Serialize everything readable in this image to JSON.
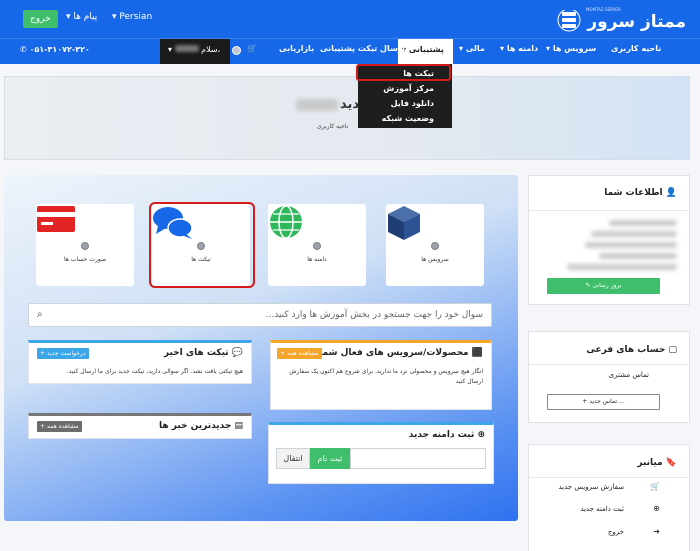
{
  "header": {
    "exit_label": "خروج",
    "messages_label": "پیام ها",
    "language_label": "Persian",
    "logo_text": "ممتاز سرور",
    "logo_sub": "MOMTAZ SERVER"
  },
  "nav": {
    "items": [
      "ناحیه کاربری",
      "سرویس ها",
      "دامنه ها",
      "مالی",
      "پشتیبانی",
      "ارسال تیکت پشتیبانی",
      "بازاریابی"
    ],
    "user_greeting": "سلام،",
    "phone": "۰۵۱-۳۱۰۷۲-۳۲۰"
  },
  "dropdown": {
    "items": [
      "تیکت ها",
      "مرکز آموزش",
      "دانلود فایل",
      "وضعیت شبکه"
    ]
  },
  "hero": {
    "title": "مدید،",
    "subtitle": "ناحیه کاربری"
  },
  "tiles": [
    {
      "label": "سرویس ها",
      "count": "0"
    },
    {
      "label": "دامنه ها",
      "count": "0"
    },
    {
      "label": "تیکت ها",
      "count": "0"
    },
    {
      "label": "صورت حساب ها",
      "count": "0"
    }
  ],
  "search": {
    "placeholder": "سوال خود را جهت جستجو در بخش آموزش ها وارد کنید..."
  },
  "panels": {
    "products": {
      "title": "محصولات/سرویس های فعال شما",
      "badge": "مشاهده همه",
      "body": "انگار هیچ سرویس و محصولی نزد ما ندارید. برای شروع هم اکنون یک سفارش ارسال کنید"
    },
    "tickets": {
      "title": "تیکت های اخیر",
      "badge": "درخواست جدید",
      "body": "هیچ تیکتی یافت نشد. اگر سوالی دارید، تیکت جدید برای ما ارسال کنید."
    },
    "news": {
      "title": "جدیدترین خبر ها",
      "badge": "مشاهده همه"
    },
    "domain": {
      "title": "ثبت دامنه جدید",
      "register_label": "ثبت نام",
      "transfer_label": "انتقال"
    }
  },
  "sidebar": {
    "info": {
      "title": "اطلاعات شما",
      "update_label": "بروز رسانی"
    },
    "subaccounts": {
      "title": "حساب های فرعی",
      "contact_label": "تماس مشتری",
      "new_contact_label": "تماس جدید ..."
    },
    "shortcuts": {
      "title": "میانبر",
      "items": [
        "سفارش سرویس جدید",
        "ثبت دامنه جدید",
        "خروج"
      ]
    }
  },
  "colors": {
    "primary": "#1768e8",
    "success": "#3fbf6b",
    "highlight": "#d61b1b"
  }
}
